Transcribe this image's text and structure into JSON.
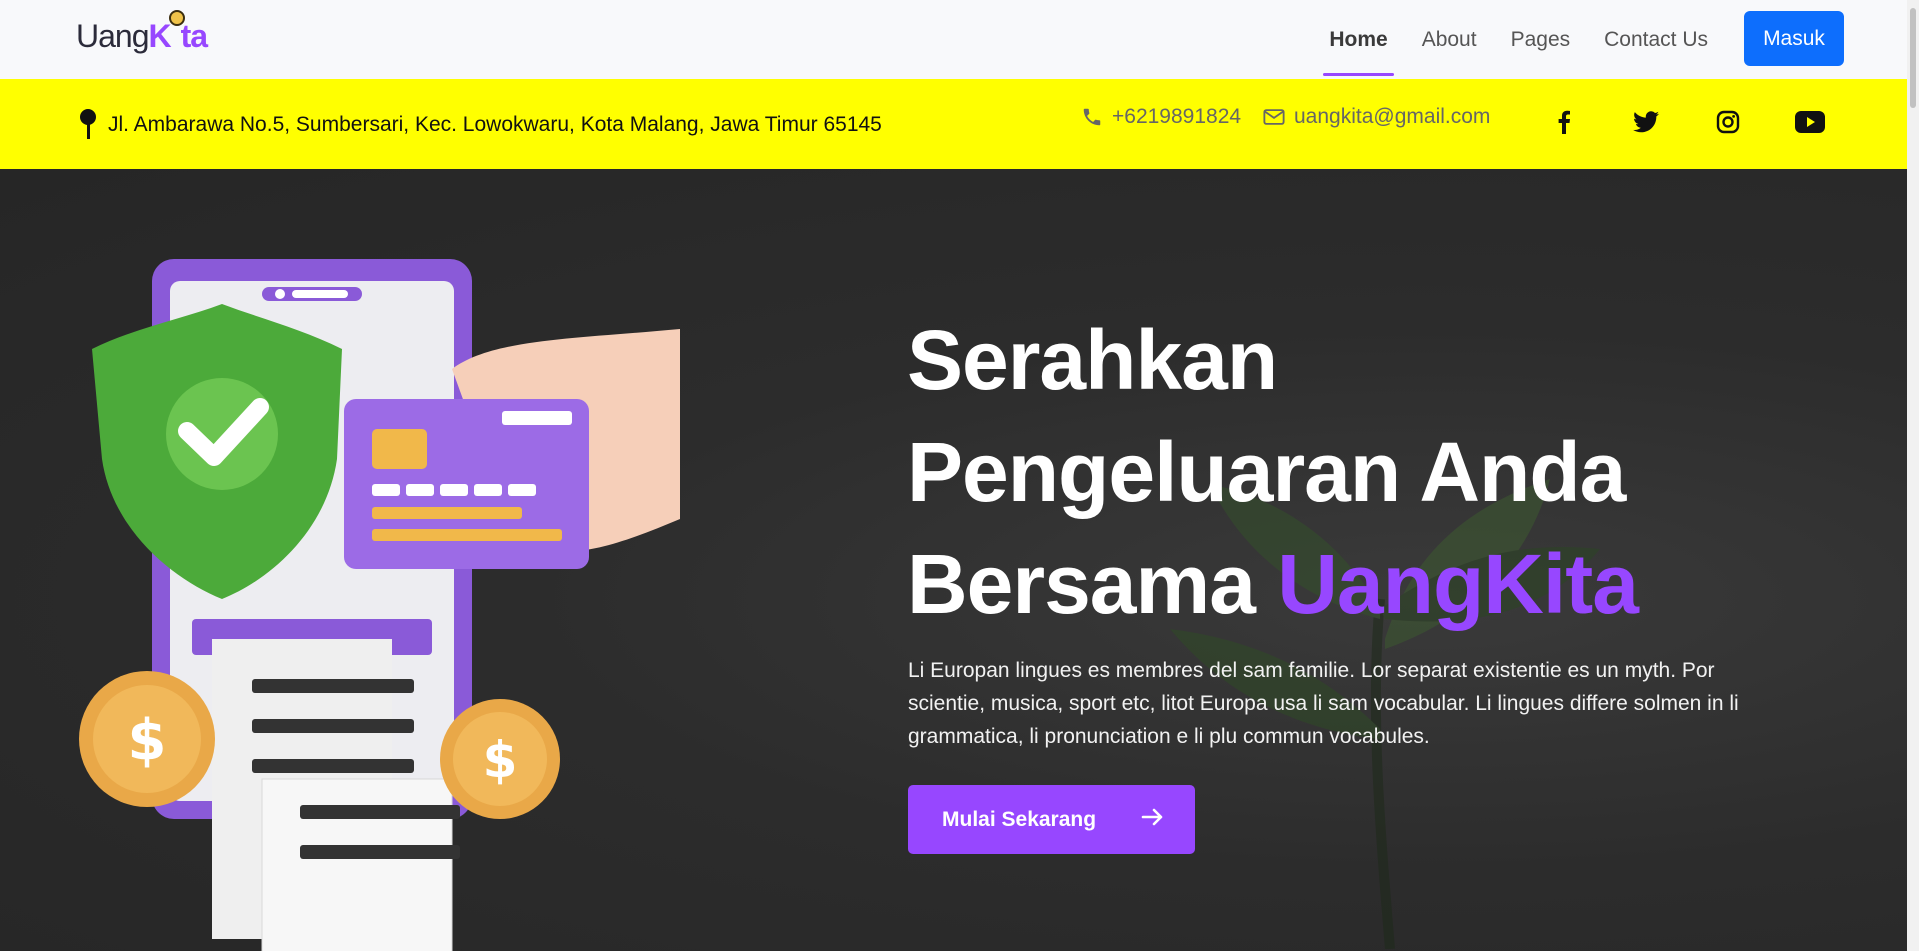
{
  "brand": {
    "logo_prefix": "Uang",
    "logo_k": "K",
    "logo_suffix": "ta"
  },
  "nav": {
    "items": [
      {
        "label": "Home",
        "active": true
      },
      {
        "label": "About",
        "active": false
      },
      {
        "label": "Pages",
        "active": false
      },
      {
        "label": "Contact Us",
        "active": false
      }
    ],
    "login_label": "Masuk"
  },
  "topbar": {
    "address": "Jl. Ambarawa No.5, Sumbersari, Kec. Lowokwaru, Kota Malang, Jawa Timur 65145",
    "phone": "+6219891824",
    "email": "uangkita@gmail.com",
    "socials": [
      "facebook-icon",
      "twitter-icon",
      "instagram-icon",
      "youtube-icon"
    ]
  },
  "hero": {
    "title_line1": "Serahkan",
    "title_line2": "Pengeluaran Anda",
    "title_line3": "Bersama ",
    "title_brand": "UangKita",
    "description": "Li Europan lingues es membres del sam familie. Lor separat existentie es un myth. Por scientie, musica, sport etc, litot Europa usa li sam vocabular. Li lingues differe solmen in li grammatica, li pronunciation e li plu commun vocabules.",
    "cta_label": "Mulai Sekarang"
  },
  "colors": {
    "accent": "#9747ff",
    "primary_button": "#0d6efd",
    "topbar_bg": "#ffff00",
    "hero_bg": "#2a2a2a"
  }
}
